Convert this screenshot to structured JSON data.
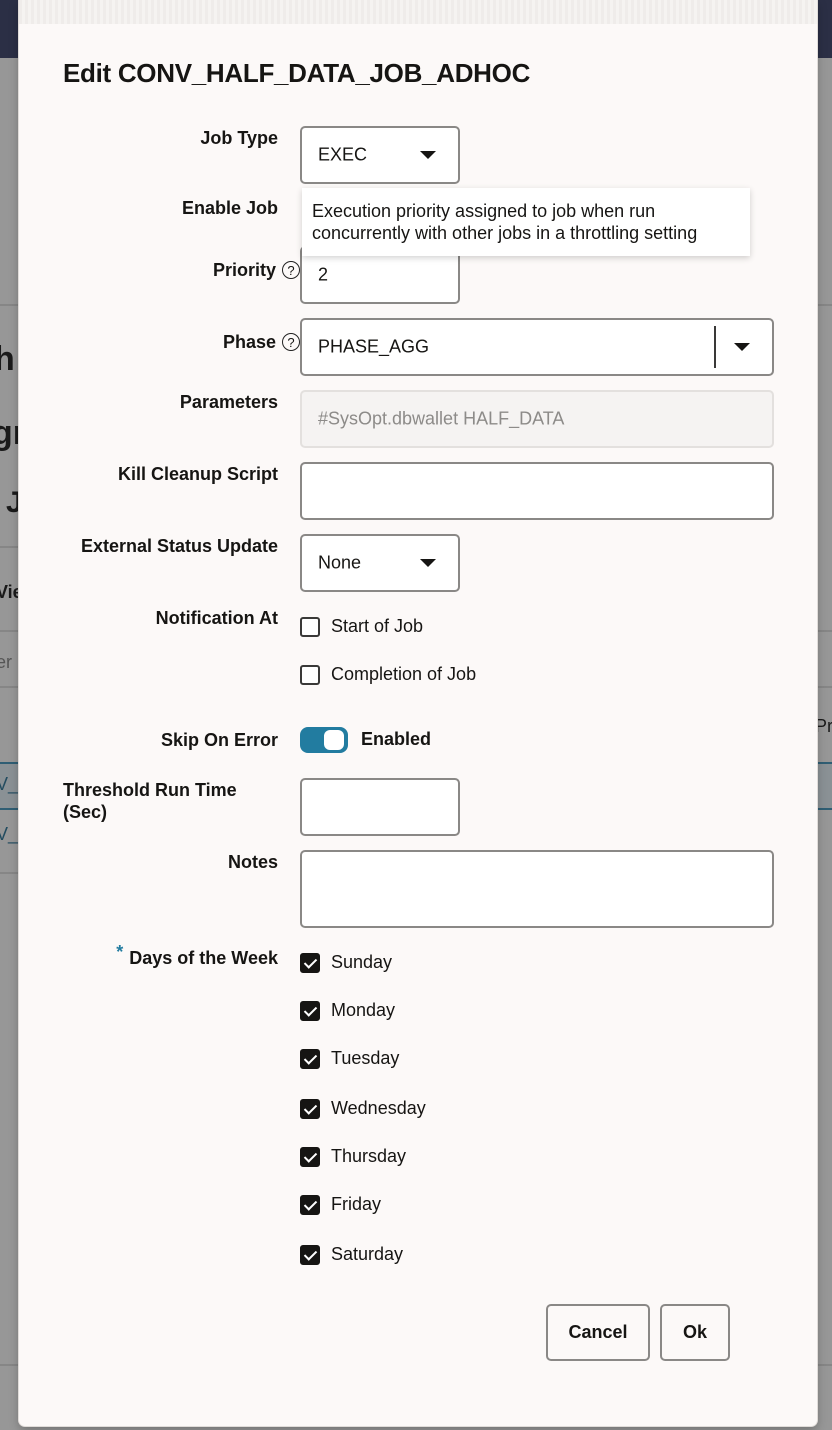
{
  "background": {
    "fragments": [
      "h",
      "gr",
      "J",
      "Vie",
      "er",
      "V_",
      "V_",
      "Pr"
    ]
  },
  "dialog": {
    "title": "Edit CONV_HALF_DATA_JOB_ADHOC",
    "fields": {
      "job_type": {
        "label": "Job Type",
        "value": "EXEC"
      },
      "enable_job": {
        "label": "Enable Job"
      },
      "priority": {
        "label": "Priority",
        "value": "2",
        "help_icon": "?"
      },
      "phase": {
        "label": "Phase",
        "value": "PHASE_AGG",
        "help_icon": "?"
      },
      "parameters": {
        "label": "Parameters",
        "value": "#SysOpt.dbwallet HALF_DATA"
      },
      "kill_cleanup_script": {
        "label": "Kill Cleanup Script",
        "value": ""
      },
      "external_status_update": {
        "label": "External Status Update",
        "value": "None"
      },
      "notification_at": {
        "label": "Notification At",
        "options": [
          {
            "label": "Start of Job",
            "checked": false
          },
          {
            "label": "Completion of Job",
            "checked": false
          }
        ]
      },
      "skip_on_error": {
        "label": "Skip On Error",
        "state": "Enabled",
        "on": true
      },
      "threshold_run_time": {
        "label_line1": "Threshold Run Time",
        "label_line2": "(Sec)",
        "value": ""
      },
      "notes": {
        "label": "Notes",
        "value": ""
      },
      "days_of_week": {
        "required_marker": "*",
        "label": "Days of the Week",
        "options": [
          {
            "label": "Sunday",
            "checked": true
          },
          {
            "label": "Monday",
            "checked": true
          },
          {
            "label": "Tuesday",
            "checked": true
          },
          {
            "label": "Wednesday",
            "checked": true
          },
          {
            "label": "Thursday",
            "checked": true
          },
          {
            "label": "Friday",
            "checked": true
          },
          {
            "label": "Saturday",
            "checked": true
          }
        ]
      }
    },
    "tooltip": {
      "line1": "Execution priority assigned to job when run",
      "line2": "concurrently with other jobs in a throttling setting"
    },
    "buttons": {
      "cancel": "Cancel",
      "ok": "Ok"
    }
  },
  "colors": {
    "accent": "#227ca0",
    "header": "#2b2f45"
  }
}
